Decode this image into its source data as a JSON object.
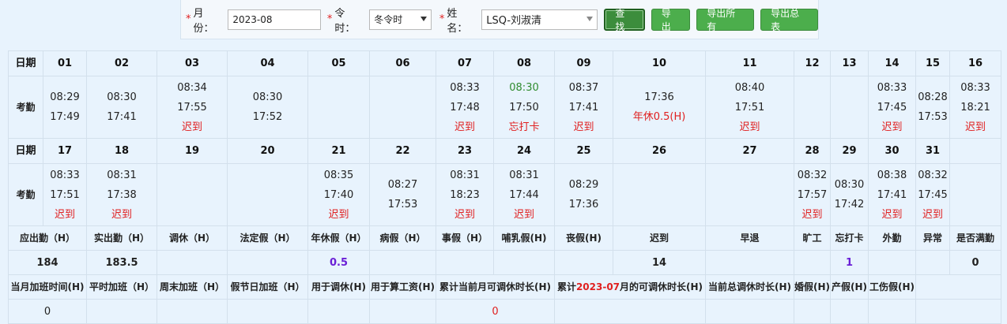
{
  "toolbar": {
    "month_label": "月份：",
    "month_value": "2023-08",
    "season_label": "令时：",
    "season_value": "冬令时",
    "name_label": "姓名：",
    "name_value": "LSQ-刘淑清",
    "buttons": [
      "查找",
      "导出",
      "导出所有",
      "导出总表"
    ]
  },
  "grid_labels": {
    "date": "日期",
    "attendance": "考勤"
  },
  "week1": {
    "days": [
      "01",
      "02",
      "03",
      "04",
      "05",
      "06",
      "07",
      "08",
      "09",
      "10",
      "11",
      "12",
      "13",
      "14",
      "15",
      "16"
    ],
    "records": [
      {
        "in": "08:29",
        "out": "17:49",
        "note": ""
      },
      {
        "in": "08:30",
        "out": "17:41",
        "note": ""
      },
      {
        "in": "08:34",
        "out": "17:55",
        "note": "迟到"
      },
      {
        "in": "08:30",
        "out": "17:52",
        "note": ""
      },
      {
        "in": "",
        "out": "",
        "note": ""
      },
      {
        "in": "",
        "out": "",
        "note": ""
      },
      {
        "in": "08:33",
        "out": "17:48",
        "note": "迟到"
      },
      {
        "in": "08:30",
        "out": "17:50",
        "note": "忘打卡"
      },
      {
        "in": "08:37",
        "out": "17:41",
        "note": "迟到"
      },
      {
        "in": "17:36",
        "out": "年休0.5(H)",
        "note": ""
      },
      {
        "in": "08:40",
        "out": "17:51",
        "note": "迟到"
      },
      {
        "in": "",
        "out": "",
        "note": ""
      },
      {
        "in": "",
        "out": "",
        "note": ""
      },
      {
        "in": "08:33",
        "out": "17:45",
        "note": "迟到"
      },
      {
        "in": "08:28",
        "out": "17:53",
        "note": ""
      },
      {
        "in": "08:33",
        "out": "18:21",
        "note": "迟到"
      }
    ]
  },
  "week2": {
    "days": [
      "17",
      "18",
      "19",
      "20",
      "21",
      "22",
      "23",
      "24",
      "25",
      "26",
      "27",
      "28",
      "29",
      "30",
      "31",
      ""
    ],
    "records": [
      {
        "in": "08:33",
        "out": "17:51",
        "note": "迟到"
      },
      {
        "in": "08:31",
        "out": "17:38",
        "note": "迟到"
      },
      {
        "in": "",
        "out": "",
        "note": ""
      },
      {
        "in": "",
        "out": "",
        "note": ""
      },
      {
        "in": "08:35",
        "out": "17:40",
        "note": "迟到"
      },
      {
        "in": "08:27",
        "out": "17:53",
        "note": ""
      },
      {
        "in": "08:31",
        "out": "18:23",
        "note": "迟到"
      },
      {
        "in": "08:31",
        "out": "17:44",
        "note": "迟到"
      },
      {
        "in": "08:29",
        "out": "17:36",
        "note": ""
      },
      {
        "in": "",
        "out": "",
        "note": ""
      },
      {
        "in": "",
        "out": "",
        "note": ""
      },
      {
        "in": "08:32",
        "out": "17:57",
        "note": "迟到"
      },
      {
        "in": "08:30",
        "out": "17:42",
        "note": ""
      },
      {
        "in": "08:38",
        "out": "17:41",
        "note": "迟到"
      },
      {
        "in": "08:32",
        "out": "17:45",
        "note": "迟到"
      },
      {
        "in": "",
        "out": "",
        "note": ""
      }
    ]
  },
  "summary": {
    "headers": [
      "应出勤（H）",
      "实出勤（H）",
      "调休（H）",
      "法定假（H）",
      "年休假（H）",
      "病假（H）",
      "事假（H）",
      "哺乳假(H)",
      "丧假(H)",
      "迟到",
      "早退",
      "旷工",
      "忘打卡",
      "外勤",
      "异常",
      "是否满勤"
    ],
    "values": [
      "184",
      "183.5",
      "",
      "",
      "0.5",
      "",
      "",
      "",
      "",
      "14",
      "",
      "",
      "1",
      "",
      "",
      "0"
    ]
  },
  "extra": {
    "headers": [
      "当月加班时间(H)",
      "平时加班（H）",
      "周末加班（H）",
      "假节日加班（H）",
      "用于调休(H)",
      "用于算工资(H)",
      "累计当前月可调休时长(H)",
      "累计",
      "2023-07",
      "月的可调休时长(H)",
      "当前总调休时长(H)",
      "婚假(H)",
      "产假(H)",
      "工伤假(H)"
    ],
    "values": [
      "0",
      "",
      "",
      "",
      "",
      "",
      "0",
      "",
      "",
      "",
      "",
      "",
      ""
    ]
  },
  "colors": {
    "late": "#e02020",
    "green": "#2e8b2e",
    "purple": "#6a1fd6"
  },
  "icons": [
    "dropdown-arrow-icon"
  ]
}
